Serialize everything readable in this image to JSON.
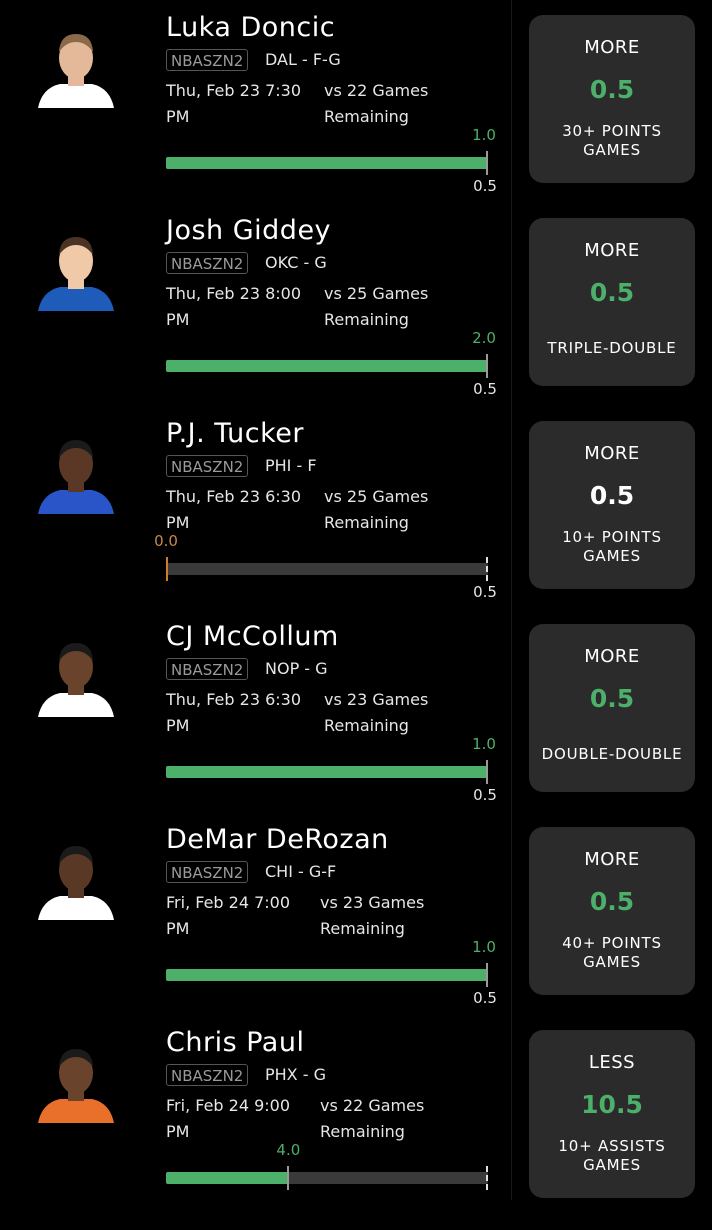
{
  "players": [
    {
      "name": "Luka Doncic",
      "league": "NBASZN2",
      "team": "DAL - F-G",
      "time": "Thu, Feb 23 7:30 PM",
      "opponent": "vs 22 Games Remaining",
      "progress_value": "1.0",
      "progress_fraction": 1.0,
      "line_label": "0.5",
      "pick": "MORE",
      "line": "0.5",
      "line_color": "#4caf6a",
      "stat": "30+ POINTS GAMES",
      "jersey_color": "#ffffff",
      "skin": "#e4b99a",
      "hair": "#8a6a4a"
    },
    {
      "name": "Josh Giddey",
      "league": "NBASZN2",
      "team": "OKC - G",
      "time": "Thu, Feb 23 8:00 PM",
      "opponent": "vs 25 Games Remaining",
      "progress_value": "2.0",
      "progress_fraction": 1.0,
      "line_label": "0.5",
      "pick": "MORE",
      "line": "0.5",
      "line_color": "#4caf6a",
      "stat": "TRIPLE-DOUBLE",
      "jersey_color": "#1f5bb8",
      "skin": "#f0c9a8",
      "hair": "#4a3322"
    },
    {
      "name": "P.J. Tucker",
      "league": "NBASZN2",
      "team": "PHI - F",
      "time": "Thu, Feb 23 6:30 PM",
      "opponent": "vs 25 Games Remaining",
      "progress_value": "0.0",
      "progress_fraction": 0.0,
      "line_label": "0.5",
      "pick": "MORE",
      "line": "0.5",
      "line_color": "#ffffff",
      "stat": "10+ POINTS GAMES",
      "jersey_color": "#2a55c9",
      "skin": "#5b3826",
      "hair": "#1b1b1b"
    },
    {
      "name": "CJ McCollum",
      "league": "NBASZN2",
      "team": "NOP - G",
      "time": "Thu, Feb 23 6:30 PM",
      "opponent": "vs 23 Games Remaining",
      "progress_value": "1.0",
      "progress_fraction": 1.0,
      "line_label": "0.5",
      "pick": "MORE",
      "line": "0.5",
      "line_color": "#4caf6a",
      "stat": "DOUBLE-DOUBLE",
      "jersey_color": "#ffffff",
      "skin": "#6a432c",
      "hair": "#1b1b1b"
    },
    {
      "name": "DeMar DeRozan",
      "league": "NBASZN2",
      "team": "CHI - G-F",
      "time": "Fri, Feb 24 7:00 PM",
      "opponent": "vs 23 Games Remaining",
      "progress_value": "1.0",
      "progress_fraction": 1.0,
      "line_label": "0.5",
      "pick": "MORE",
      "line": "0.5",
      "line_color": "#4caf6a",
      "stat": "40+ POINTS GAMES",
      "jersey_color": "#ffffff",
      "skin": "#5a3826",
      "hair": "#1b1b1b"
    },
    {
      "name": "Chris Paul",
      "league": "NBASZN2",
      "team": "PHX - G",
      "time": "Fri, Feb 24 9:00 PM",
      "opponent": "vs 22 Games Remaining",
      "progress_value": "4.0",
      "progress_fraction": 0.38,
      "line_label": "",
      "pick": "LESS",
      "line": "10.5",
      "line_color": "#4caf6a",
      "stat": "10+ ASSISTS GAMES",
      "jersey_color": "#e8702a",
      "skin": "#6a432c",
      "hair": "#1b1b1b"
    }
  ]
}
